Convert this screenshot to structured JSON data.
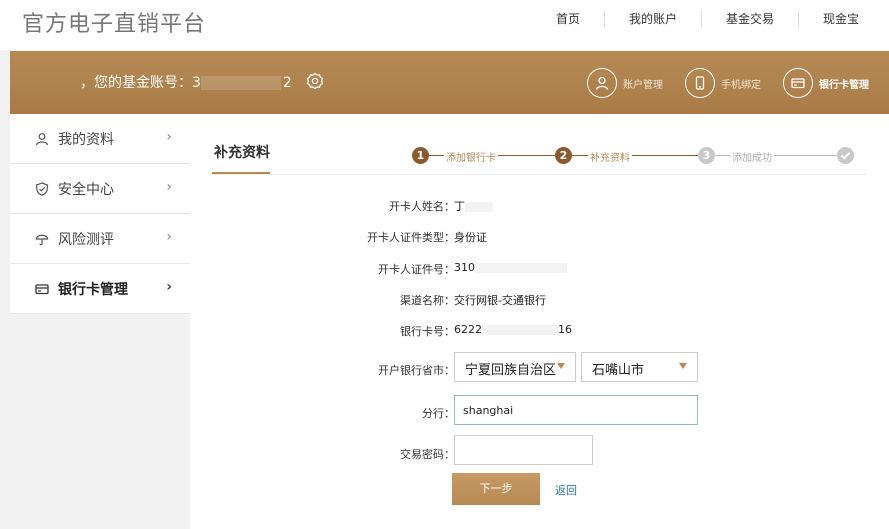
{
  "site_title": "官方电子直销平台",
  "nav": [
    "首页",
    "我的账户",
    "基金交易",
    "现金宝"
  ],
  "account_bar": {
    "label": "，您的基金账号：3",
    "suffix": "2",
    "actions": [
      {
        "label": "账户管理",
        "icon": "user-icon",
        "active": false
      },
      {
        "label": "手机绑定",
        "icon": "phone-icon",
        "active": false
      },
      {
        "label": "银行卡管理",
        "icon": "card-icon",
        "active": true
      }
    ]
  },
  "sidebar": [
    {
      "label": "我的资料",
      "icon": "user-icon",
      "active": false
    },
    {
      "label": "安全中心",
      "icon": "shield-icon",
      "active": false
    },
    {
      "label": "风险测评",
      "icon": "umbrella-icon",
      "active": false
    },
    {
      "label": "银行卡管理",
      "icon": "card-icon",
      "active": true
    }
  ],
  "tab_title": "补充资料",
  "steps": [
    {
      "num": "1",
      "label": "添加银行卡",
      "status": "done"
    },
    {
      "num": "2",
      "label": "补充资料",
      "status": "done"
    },
    {
      "num": "3",
      "label": "添加成功",
      "status": "todo"
    }
  ],
  "form": {
    "name": {
      "label": "开卡人姓名：",
      "value": "丁"
    },
    "id_type": {
      "label": "开卡人证件类型：",
      "value": "身份证"
    },
    "id_no": {
      "label": "开卡人证件号：",
      "value": "310"
    },
    "channel": {
      "label": "渠道名称：",
      "value": "交行网银-交通银行"
    },
    "card_no": {
      "label": "银行卡号：",
      "value": "6222",
      "tail": "16"
    },
    "province_city": {
      "label": "开户银行省市：",
      "province": "宁夏回族自治区",
      "city": "石嘴山市"
    },
    "branch": {
      "label": "分行：",
      "value": "shanghai"
    },
    "password": {
      "label": "交易密码：",
      "value": ""
    }
  },
  "buttons": {
    "next": "下一步",
    "back": "返回"
  }
}
